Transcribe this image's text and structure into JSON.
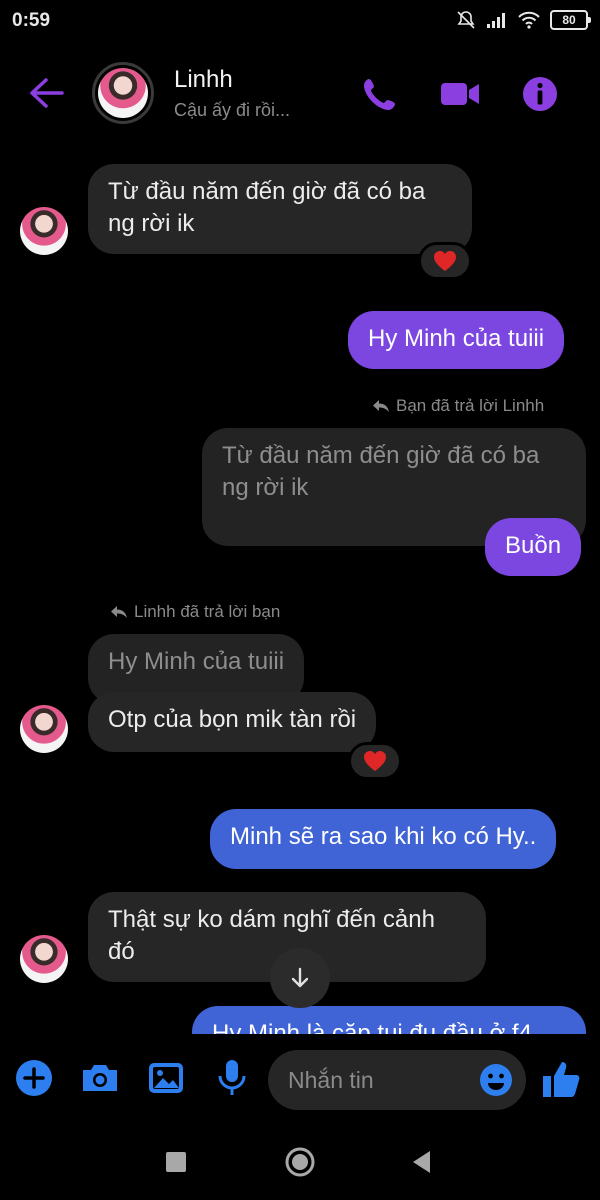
{
  "status_bar": {
    "time": "0:59",
    "battery": "80"
  },
  "header": {
    "contact_name": "Linhh",
    "contact_status": "Cậu ấy đi rồi...",
    "accent": "#8b3fe0"
  },
  "messages": {
    "m1": {
      "text_line1": "Từ đầu năm đến giờ đã có ba",
      "text_line2": "ng rời ik",
      "reaction": "heart"
    },
    "m2": {
      "text": "Hy Minh của tuiii"
    },
    "reply_note_you": "Bạn đã trả lời Linhh",
    "m3_quote": {
      "line1": "Từ đầu năm đến giờ đã có ba",
      "line2": "ng rời ik"
    },
    "m3": {
      "text": "Buồn"
    },
    "reply_note_them": "Linhh đã trả lời bạn",
    "m4_quote": {
      "text": "Hy Minh của tuiii"
    },
    "m4": {
      "text": "Otp của bọn mik tàn rồi",
      "reaction": "heart"
    },
    "m5": {
      "text": "Minh sẽ ra sao khi ko có Hy.."
    },
    "m6": {
      "text_line1": "Thật sự ko dám nghĩ đến cảnh",
      "text_line2": "đó"
    },
    "m7": {
      "text": "Hy Minh là cặp tui đu đầu ở f4"
    }
  },
  "composer": {
    "placeholder": "Nhắn tin"
  },
  "colors": {
    "purple_bubble": "#7b47e0",
    "blue_bubble": "#4063d6",
    "incoming_bubble": "#262626",
    "icon_blue": "#2d7ff0"
  }
}
